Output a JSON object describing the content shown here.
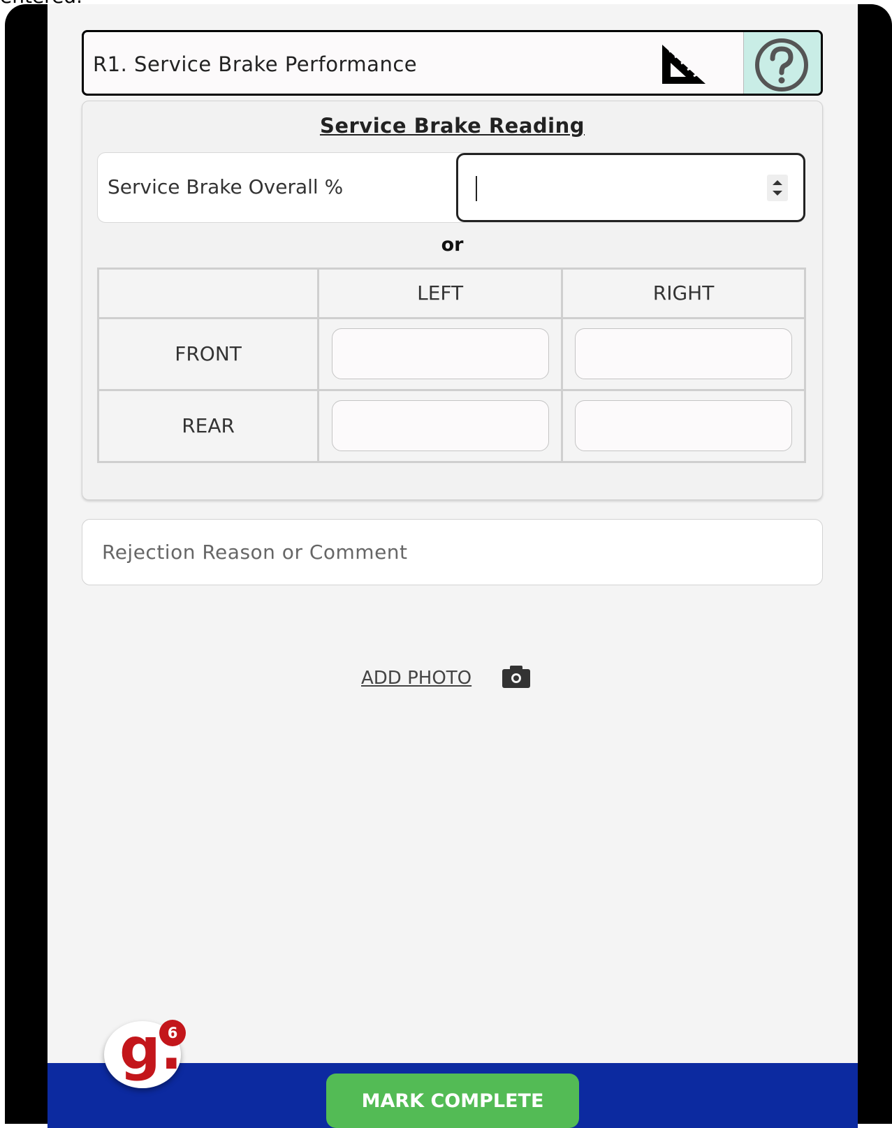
{
  "page": {
    "top_text": "entered."
  },
  "item": {
    "title": "R1. Service Brake Performance"
  },
  "reading": {
    "title": "Service Brake Reading",
    "overall_label": "Service Brake Overall %",
    "overall_value": "",
    "or_text": "or",
    "columns": [
      "LEFT",
      "RIGHT"
    ],
    "rows": [
      "FRONT",
      "REAR"
    ],
    "values": {
      "front_left": "",
      "front_right": "",
      "rear_left": "",
      "rear_right": ""
    }
  },
  "comment": {
    "placeholder": "Rejection Reason or Comment"
  },
  "photo": {
    "label": "ADD PHOTO"
  },
  "footer": {
    "complete_label": "MARK COMPLETE"
  },
  "app_badge": {
    "letter": "g.",
    "count": "6"
  },
  "colors": {
    "accent_bar": "#0c2aa0",
    "complete_button": "#53bb55",
    "help_background": "#c9ede6",
    "brand_red": "#c3161b"
  },
  "icons": [
    "ruler-icon",
    "help-icon",
    "spinner-icon",
    "camera-icon"
  ]
}
